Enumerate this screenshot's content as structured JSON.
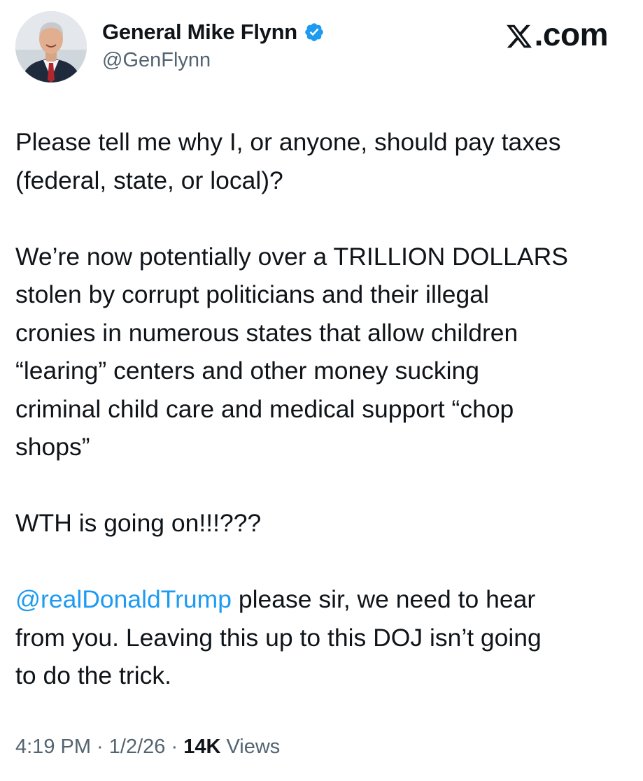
{
  "author": {
    "display_name": "General Mike Flynn",
    "handle": "@GenFlynn",
    "verified": true,
    "avatar_icon": "profile-photo"
  },
  "brand": {
    "label": ".com",
    "logo_icon": "x-logo-icon"
  },
  "tweet": {
    "paragraph_1": "Please tell me why I, or anyone, should pay taxes\n(federal, state, or local)?",
    "paragraph_2": "We’re now potentially over a TRILLION DOLLARS\nstolen by corrupt politicians and their illegal\ncronies in numerous states that allow children\n“learing” centers and other money sucking\ncriminal child care and medical support “chop\nshops”",
    "paragraph_3": "WTH is going on!!!???",
    "paragraph_4_mention": "@realDonaldTrump",
    "paragraph_4_text": " please sir, we need to hear\nfrom you. Leaving this up to this DOJ isn’t going\nto do the trick."
  },
  "meta": {
    "time": "4:19 PM",
    "separator_1": " · ",
    "date": "1/2/26",
    "separator_2": " · ",
    "views_count": "14K",
    "views_label": " Views"
  },
  "colors": {
    "text": "#0f1419",
    "secondary": "#536471",
    "link": "#1d9bf0",
    "verified_badge": "#1d9bf0"
  }
}
